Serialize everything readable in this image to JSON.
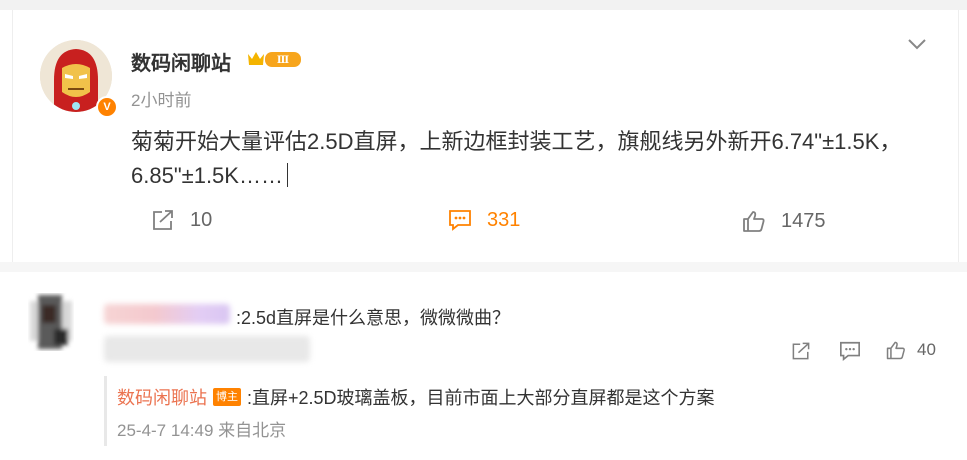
{
  "post": {
    "author": "数码闲聊站",
    "level_badge": "Ⅲ",
    "verified_mark": "V",
    "time": "2小时前",
    "text": "菊菊开始大量评估2.5D直屏，上新边框封装工艺，旗舰线另外新开6.74\"±1.5K，6.85\"±1.5K……",
    "actions": {
      "repost_count": "10",
      "comment_count": "331",
      "like_count": "1475"
    }
  },
  "comment": {
    "text": ":2.5d直屏是什么意思，微微微曲？",
    "like_count": "40",
    "reply": {
      "author": "数码闲聊站",
      "author_badge": "博主",
      "text": ":直屏+2.5D玻璃盖板，目前市面上大部分直屏都是这个方案",
      "meta": "25-4-7 14:49 来自北京"
    }
  },
  "colors": {
    "accent": "#ff8200",
    "link": "#eb7350",
    "muted": "#939393"
  }
}
